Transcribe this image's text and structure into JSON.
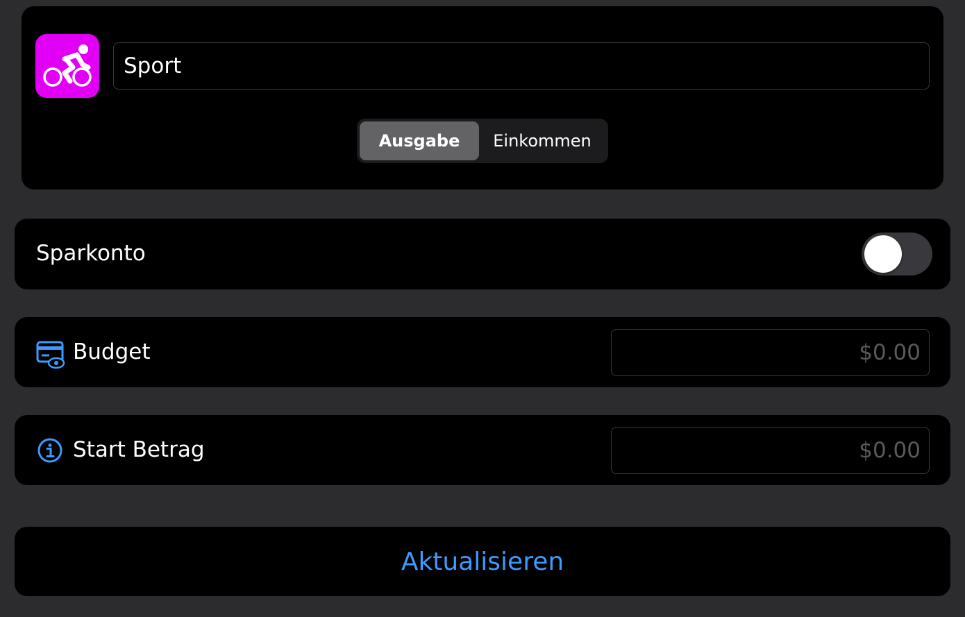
{
  "category": {
    "icon": "bicycle-icon",
    "icon_background": "#e100f5",
    "name_value": "Sport",
    "type_segments": [
      {
        "label": "Ausgabe",
        "selected": true
      },
      {
        "label": "Einkommen",
        "selected": false
      }
    ]
  },
  "savings": {
    "label": "Sparkonto",
    "toggle_on": false
  },
  "budget": {
    "icon": "creditcard-eye-icon",
    "label": "Budget",
    "placeholder": "$0.00"
  },
  "start_amount": {
    "icon": "info-circle-icon",
    "label": "Start Betrag",
    "placeholder": "$0.00"
  },
  "update_button": {
    "label": "Aktualisieren"
  },
  "colors": {
    "accent": "#3d9bff",
    "background": "#2c2c2e",
    "card": "#000000"
  }
}
